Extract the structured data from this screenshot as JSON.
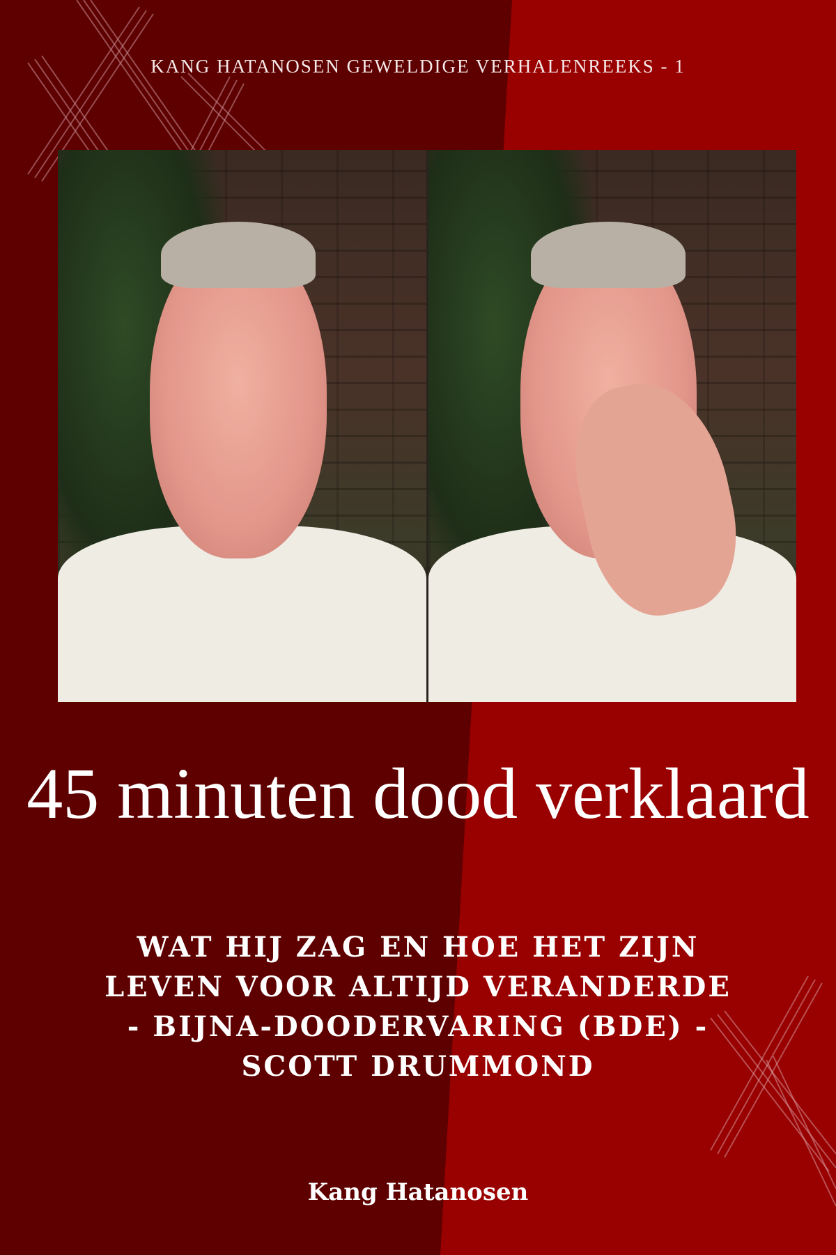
{
  "cover": {
    "series": "KANG HATANOSEN GEWELDIGE VERHALENREEKS - 1",
    "title": "45 minuten dood verklaard",
    "subtitle": "WAT HIJ ZAG EN HOE HET ZIJN LEVEN VOOR ALTIJD VERANDERDE - BIJNA-DOODERVARING (BDE) - SCOTT DRUMMOND",
    "author": "Kang Hatanosen"
  },
  "colors": {
    "dark_red": "#5e0000",
    "bright_red": "#990000",
    "text": "#ffffff"
  }
}
